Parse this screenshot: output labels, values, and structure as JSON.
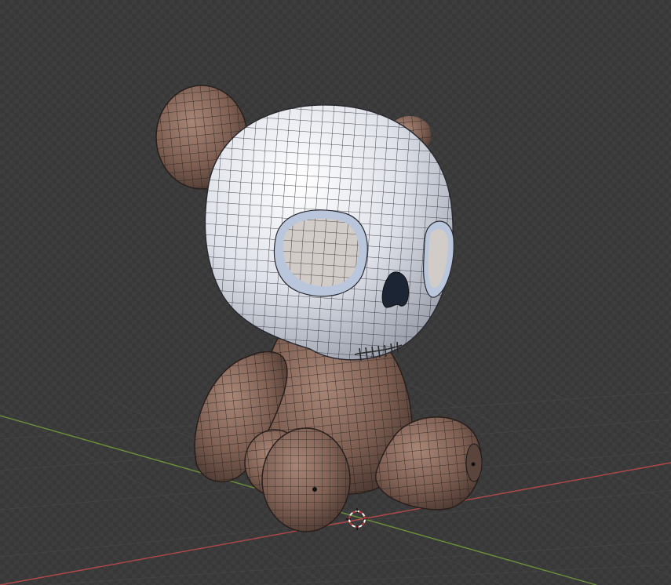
{
  "viewport": {
    "mode": "3d-viewport",
    "shading": "solid-wireframe-overlay",
    "background_color": "#3a3a3a",
    "grid_line_color": "#444444",
    "x_axis_color": "#b24848",
    "y_axis_color": "#6a8f3a"
  },
  "object": {
    "name_semantic": "skull-bear-plush",
    "body_color": "#8a6a5c",
    "skull_color": "#e6e8ee",
    "wire_color": "#1b1b1b"
  },
  "cursor_3d": {
    "color_outer": "#ffffff",
    "color_inner": "#c23b3b"
  }
}
